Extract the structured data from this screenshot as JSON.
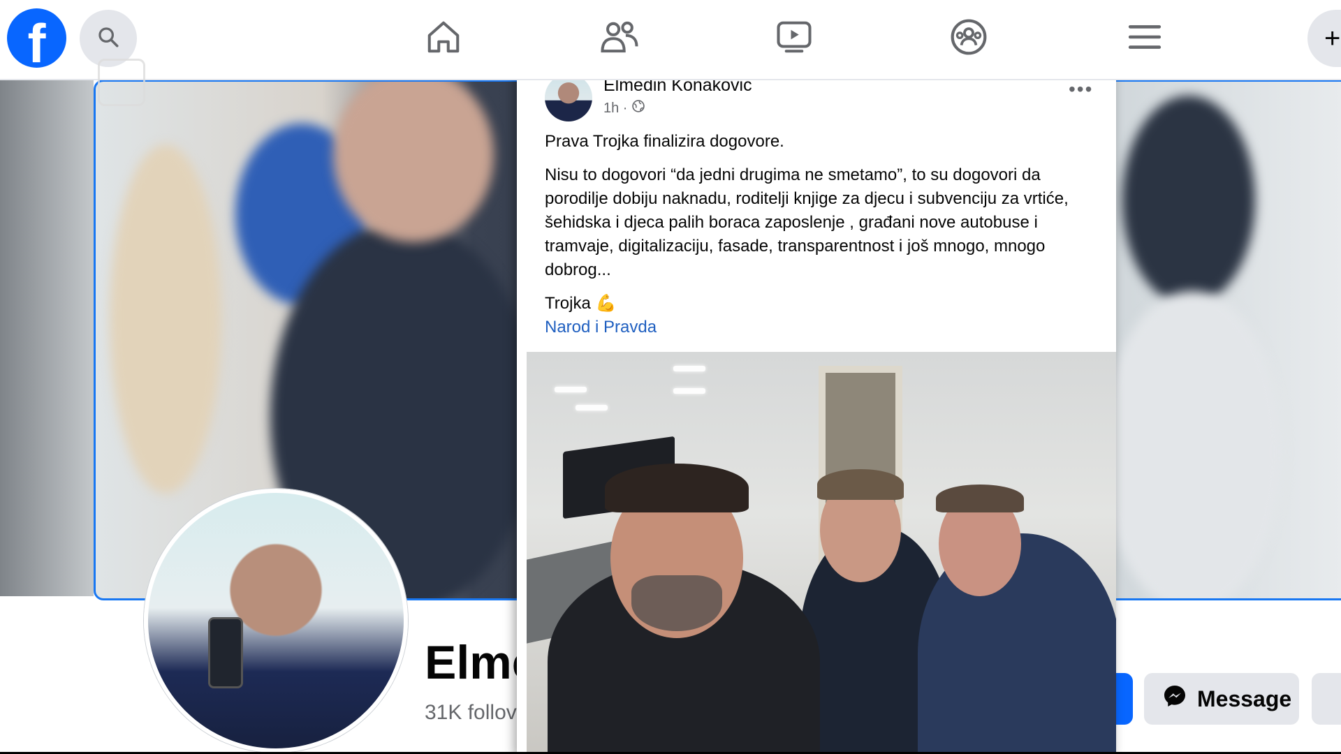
{
  "nav": {
    "logo_letter": "f",
    "icons": [
      "search-icon",
      "home-icon",
      "friends-icon",
      "video-icon",
      "groups-icon",
      "menu-icon",
      "plus-icon"
    ],
    "create_symbol": "+"
  },
  "profile": {
    "name_partial": "Elme",
    "followers_partial": "31K follov",
    "message_label": "Message"
  },
  "post": {
    "author": "Elmedin Konakovic",
    "time": "1h ·",
    "more": "•••",
    "line1": "Prava Trojka finalizira dogovore.",
    "body": "Nisu to dogovori “da jedni drugima ne smetamo”, to su dogovori da porodilje dobiju naknadu, roditelji knjige za djecu i subvenciju za vrtiće, šehidska i djeca palih boraca zaposlenje , građani nove autobuse i tramvaje, digitalizaciju, fasade, transparentnost i još mnogo, mnogo dobrog...",
    "trojka": "Trojka 💪",
    "hashtag": "Narod i Pravda"
  },
  "colors": {
    "facebook_blue": "#0866ff",
    "link_blue": "#1f5fc0",
    "button_gray": "#e4e6eb"
  }
}
